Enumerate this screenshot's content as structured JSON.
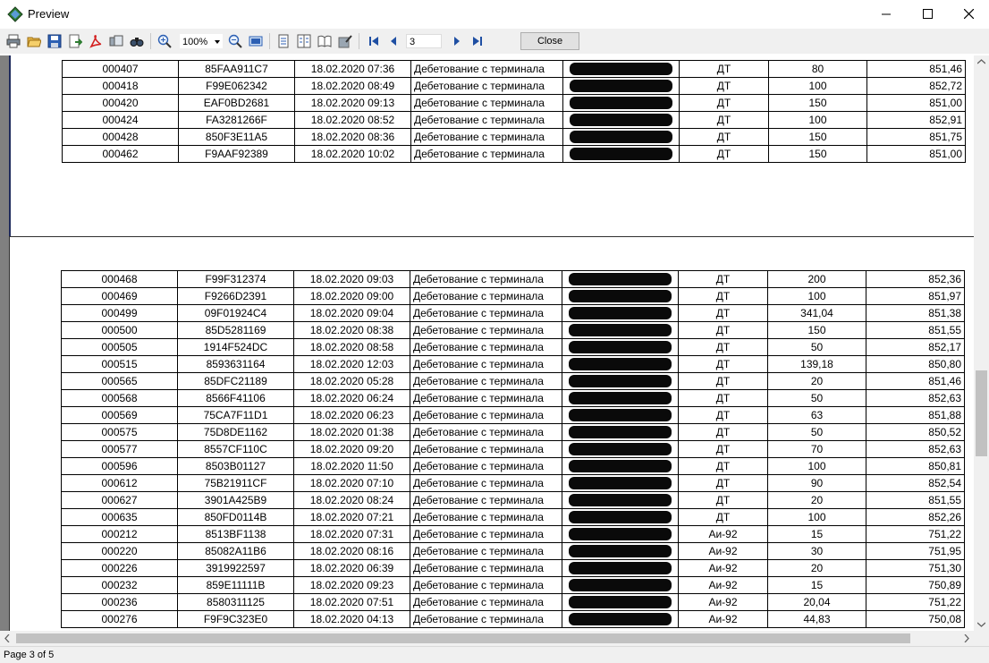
{
  "window": {
    "title": "Preview"
  },
  "toolbar": {
    "zoom_value": "100%",
    "page_number": "3",
    "close_label": "Close",
    "icons": [
      "print-icon",
      "open-icon",
      "save-icon",
      "export-icon",
      "pdf-icon",
      "email-icon",
      "find-icon",
      "zoom-in-icon",
      "zoom-out-icon",
      "fit-page-icon",
      "single-page-icon",
      "multi-page-icon",
      "book-icon",
      "edit-icon",
      "first-page-icon",
      "prev-page-icon",
      "next-page-icon",
      "last-page-icon"
    ]
  },
  "status": {
    "page_info": "Page 3 of 5"
  },
  "report": {
    "page1_rows": [
      {
        "id": "000407",
        "card": "85FAA911C7",
        "datetime": "18.02.2020 07:36",
        "operation": "Дебетование с терминала",
        "fuel": "ДТ",
        "qty": "80",
        "price": "851,46"
      },
      {
        "id": "000418",
        "card": "F99E062342",
        "datetime": "18.02.2020 08:49",
        "operation": "Дебетование с терминала",
        "fuel": "ДТ",
        "qty": "100",
        "price": "852,72"
      },
      {
        "id": "000420",
        "card": "EAF0BD2681",
        "datetime": "18.02.2020 09:13",
        "operation": "Дебетование с терминала",
        "fuel": "ДТ",
        "qty": "150",
        "price": "851,00"
      },
      {
        "id": "000424",
        "card": "FA3281266F",
        "datetime": "18.02.2020 08:52",
        "operation": "Дебетование с терминала",
        "fuel": "ДТ",
        "qty": "100",
        "price": "852,91"
      },
      {
        "id": "000428",
        "card": "850F3E11A5",
        "datetime": "18.02.2020 08:36",
        "operation": "Дебетование с терминала",
        "fuel": "ДТ",
        "qty": "150",
        "price": "851,75"
      },
      {
        "id": "000462",
        "card": "F9AAF92389",
        "datetime": "18.02.2020 10:02",
        "operation": "Дебетование с терминала",
        "fuel": "ДТ",
        "qty": "150",
        "price": "851,00"
      }
    ],
    "page2_rows": [
      {
        "id": "000468",
        "card": "F99F312374",
        "datetime": "18.02.2020 09:03",
        "operation": "Дебетование с терминала",
        "fuel": "ДТ",
        "qty": "200",
        "price": "852,36"
      },
      {
        "id": "000469",
        "card": "F9266D2391",
        "datetime": "18.02.2020 09:00",
        "operation": "Дебетование с терминала",
        "fuel": "ДТ",
        "qty": "100",
        "price": "851,97"
      },
      {
        "id": "000499",
        "card": "09F01924C4",
        "datetime": "18.02.2020 09:04",
        "operation": "Дебетование с терминала",
        "fuel": "ДТ",
        "qty": "341,04",
        "price": "851,38"
      },
      {
        "id": "000500",
        "card": "85D5281169",
        "datetime": "18.02.2020 08:38",
        "operation": "Дебетование с терминала",
        "fuel": "ДТ",
        "qty": "150",
        "price": "851,55"
      },
      {
        "id": "000505",
        "card": "1914F524DC",
        "datetime": "18.02.2020 08:58",
        "operation": "Дебетование с терминала",
        "fuel": "ДТ",
        "qty": "50",
        "price": "852,17"
      },
      {
        "id": "000515",
        "card": "8593631164",
        "datetime": "18.02.2020 12:03",
        "operation": "Дебетование с терминала",
        "fuel": "ДТ",
        "qty": "139,18",
        "price": "850,80"
      },
      {
        "id": "000565",
        "card": "85DFC21189",
        "datetime": "18.02.2020 05:28",
        "operation": "Дебетование с терминала",
        "fuel": "ДТ",
        "qty": "20",
        "price": "851,46"
      },
      {
        "id": "000568",
        "card": "8566F41106",
        "datetime": "18.02.2020 06:24",
        "operation": "Дебетование с терминала",
        "fuel": "ДТ",
        "qty": "50",
        "price": "852,63"
      },
      {
        "id": "000569",
        "card": "75CA7F11D1",
        "datetime": "18.02.2020 06:23",
        "operation": "Дебетование с терминала",
        "fuel": "ДТ",
        "qty": "63",
        "price": "851,88"
      },
      {
        "id": "000575",
        "card": "75D8DE1162",
        "datetime": "18.02.2020 01:38",
        "operation": "Дебетование с терминала",
        "fuel": "ДТ",
        "qty": "50",
        "price": "850,52"
      },
      {
        "id": "000577",
        "card": "8557CF110C",
        "datetime": "18.02.2020 09:20",
        "operation": "Дебетование с терминала",
        "fuel": "ДТ",
        "qty": "70",
        "price": "852,63"
      },
      {
        "id": "000596",
        "card": "8503B01127",
        "datetime": "18.02.2020 11:50",
        "operation": "Дебетование с терминала",
        "fuel": "ДТ",
        "qty": "100",
        "price": "850,81"
      },
      {
        "id": "000612",
        "card": "75B21911CF",
        "datetime": "18.02.2020 07:10",
        "operation": "Дебетование с терминала",
        "fuel": "ДТ",
        "qty": "90",
        "price": "852,54"
      },
      {
        "id": "000627",
        "card": "3901A425B9",
        "datetime": "18.02.2020 08:24",
        "operation": "Дебетование с терминала",
        "fuel": "ДТ",
        "qty": "20",
        "price": "851,55"
      },
      {
        "id": "000635",
        "card": "850FD0114B",
        "datetime": "18.02.2020 07:21",
        "operation": "Дебетование с терминала",
        "fuel": "ДТ",
        "qty": "100",
        "price": "852,26"
      },
      {
        "id": "000212",
        "card": "8513BF1138",
        "datetime": "18.02.2020 07:31",
        "operation": "Дебетование с терминала",
        "fuel": "Аи-92",
        "qty": "15",
        "price": "751,22"
      },
      {
        "id": "000220",
        "card": "85082A11B6",
        "datetime": "18.02.2020 08:16",
        "operation": "Дебетование с терминала",
        "fuel": "Аи-92",
        "qty": "30",
        "price": "751,95"
      },
      {
        "id": "000226",
        "card": "3919922597",
        "datetime": "18.02.2020 06:39",
        "operation": "Дебетование с терминала",
        "fuel": "Аи-92",
        "qty": "20",
        "price": "751,30"
      },
      {
        "id": "000232",
        "card": "859E11111B",
        "datetime": "18.02.2020 09:23",
        "operation": "Дебетование с терминала",
        "fuel": "Аи-92",
        "qty": "15",
        "price": "750,89"
      },
      {
        "id": "000236",
        "card": "8580311125",
        "datetime": "18.02.2020 07:51",
        "operation": "Дебетование с терминала",
        "fuel": "Аи-92",
        "qty": "20,04",
        "price": "751,22"
      },
      {
        "id": "000276",
        "card": "F9F9C323E0",
        "datetime": "18.02.2020 04:13",
        "operation": "Дебетование с терминала",
        "fuel": "Аи-92",
        "qty": "44,83",
        "price": "750,08"
      }
    ]
  }
}
